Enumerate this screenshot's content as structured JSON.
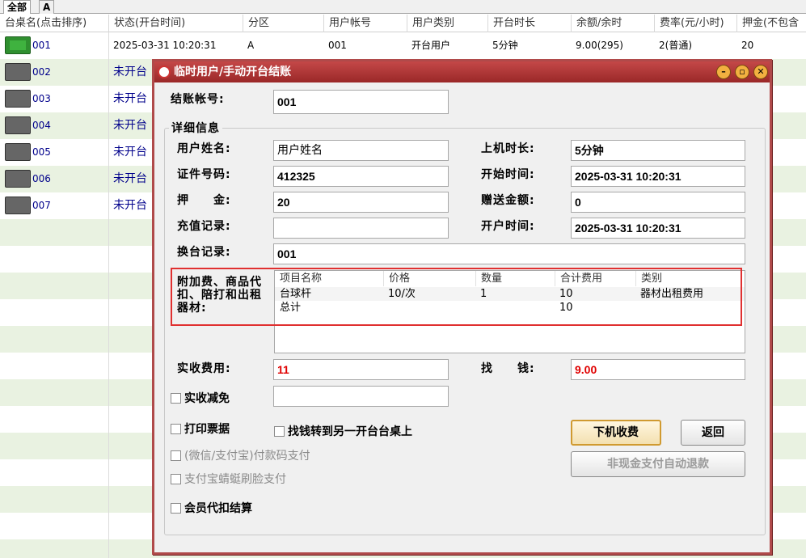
{
  "tabs": [
    {
      "label": "全部"
    },
    {
      "label": "A"
    }
  ],
  "table": {
    "headers": [
      "台桌名(点击排序)",
      "状态(开台时间)",
      "分区",
      "用户帐号",
      "用户类别",
      "开台时长",
      "余额/余时",
      "费率(元/小时)",
      "押金(不包含"
    ],
    "rows": [
      {
        "name": "001",
        "status": "2025-03-31 10:20:31",
        "zone": "A",
        "account": "001",
        "type": "开台用户",
        "duration": "5分钟",
        "balance": "9.00(295)",
        "rate": "2(普通)",
        "deposit": "20"
      },
      {
        "name": "002",
        "status": "未开台"
      },
      {
        "name": "003",
        "status": "未开台"
      },
      {
        "name": "004",
        "status": "未开台"
      },
      {
        "name": "005",
        "status": "未开台"
      },
      {
        "name": "006",
        "status": "未开台"
      },
      {
        "name": "007",
        "status": "未开台"
      }
    ]
  },
  "dialog": {
    "title": "临时用户/手动开台结账",
    "account_label": "结账帐号:",
    "account_value": "001",
    "group_label": "详细信息",
    "username_label": "用户姓名:",
    "username_value": "用户姓名",
    "idno_label": "证件号码:",
    "idno_value": "412325",
    "deposit_label": "押　　金:",
    "deposit_value": "20",
    "recharge_label": "充值记录:",
    "recharge_value": "",
    "change_label": "换台记录:",
    "change_value": "001",
    "duration_label": "上机时长:",
    "duration_value": "5分钟",
    "start_label": "开始时间:",
    "start_value": "2025-03-31 10:20:31",
    "gift_label": "赠送金额:",
    "gift_value": "0",
    "open_label": "开户时间:",
    "open_value": "2025-03-31 10:20:31",
    "extras_label": "附加费、商品代扣、陪打和出租器材:",
    "grid": {
      "headers": [
        "项目名称",
        "价格",
        "数量",
        "合计费用",
        "类别"
      ],
      "rows": [
        [
          "台球杆",
          "10/次",
          "1",
          "10",
          "器材出租费用"
        ],
        [
          "总计",
          "",
          "",
          "10",
          ""
        ]
      ]
    },
    "actual_label": "实收费用:",
    "actual_value": "11",
    "change_money_label": "找　　钱:",
    "change_money_value": "9.00",
    "reduce_label": "实收减免",
    "reduce_value": "",
    "print_label": "打印票据",
    "transfer_label": "找钱转到另一开台台桌上",
    "wechat_label": "(微信/支付宝)付款码支付",
    "alipay_face_label": "支付宝蜻蜓刷脸支付",
    "member_label": "会员代扣结算",
    "checkout_button": "下机收费",
    "back_button": "返回",
    "refund_button": "非现金支付自动退款"
  },
  "colors": {
    "title_bar": "#b03a3a",
    "row_alt": "#e9f2e1",
    "highlight": "#e03030",
    "red_value": "#e00000"
  }
}
